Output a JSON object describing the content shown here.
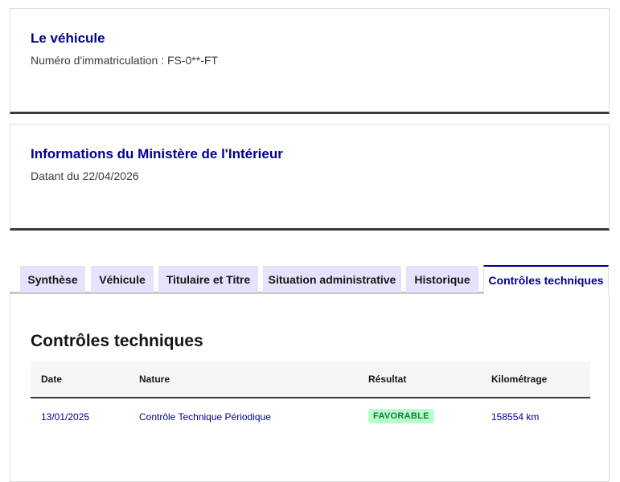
{
  "vehicle": {
    "title": "Le véhicule",
    "plate_line": "Numéro d'immatriculation : FS-0**-FT"
  },
  "ministry": {
    "title": "Informations du Ministère de l'Intérieur",
    "date_line": "Datant du 22/04/2026"
  },
  "tabs": [
    {
      "label": "Synthèse",
      "active": false
    },
    {
      "label": "Véhicule",
      "active": false
    },
    {
      "label": "Titulaire et Titre",
      "active": false
    },
    {
      "label": "Situation administrative",
      "active": false
    },
    {
      "label": "Historique",
      "active": false
    },
    {
      "label": "Contrôles techniques",
      "active": true
    }
  ],
  "panel": {
    "title": "Contrôles techniques",
    "table": {
      "headers": [
        "Date",
        "Nature",
        "Résultat",
        "Kilométrage"
      ],
      "rows": [
        {
          "date": "13/01/2025",
          "nature": "Contrôle Technique Périodique",
          "result": "FAVORABLE",
          "mileage": "158554 km"
        }
      ]
    }
  },
  "colors": {
    "accent": "#000091",
    "tab_bg": "#e3e3fd",
    "success_bg": "#b8fec9",
    "success_text": "#18753c"
  }
}
